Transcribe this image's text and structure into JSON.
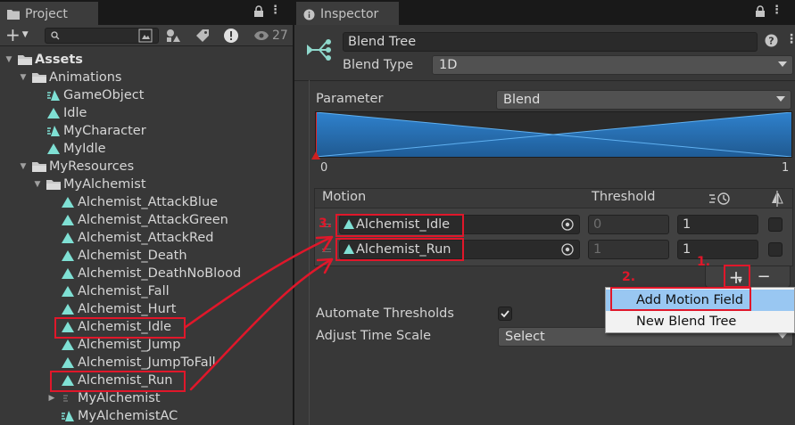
{
  "project": {
    "tab_label": "Project",
    "hidden_count": "27",
    "tree": [
      {
        "label": "Assets",
        "bold": true,
        "arrow": "down",
        "icon": "folder-icon"
      },
      {
        "label": "Animations",
        "bold": false,
        "arrow": "down",
        "icon": "folder-icon"
      },
      {
        "label": "GameObject",
        "bold": false,
        "arrow": "",
        "icon": "animator-controller-icon"
      },
      {
        "label": "Idle",
        "bold": false,
        "arrow": "",
        "icon": "animation-clip-icon"
      },
      {
        "label": "MyCharacter",
        "bold": false,
        "arrow": "",
        "icon": "animator-controller-icon"
      },
      {
        "label": "MyIdle",
        "bold": false,
        "arrow": "",
        "icon": "animation-clip-icon"
      },
      {
        "label": "MyResources",
        "bold": false,
        "arrow": "down",
        "icon": "folder-icon"
      },
      {
        "label": "MyAlchemist",
        "bold": false,
        "arrow": "down",
        "icon": "folder-icon"
      },
      {
        "label": "Alchemist_AttackBlue",
        "bold": false,
        "arrow": "",
        "icon": "animation-clip-icon"
      },
      {
        "label": "Alchemist_AttackGreen",
        "bold": false,
        "arrow": "",
        "icon": "animation-clip-icon"
      },
      {
        "label": "Alchemist_AttackRed",
        "bold": false,
        "arrow": "",
        "icon": "animation-clip-icon"
      },
      {
        "label": "Alchemist_Death",
        "bold": false,
        "arrow": "",
        "icon": "animation-clip-icon"
      },
      {
        "label": "Alchemist_DeathNoBlood",
        "bold": false,
        "arrow": "",
        "icon": "animation-clip-icon"
      },
      {
        "label": "Alchemist_Fall",
        "bold": false,
        "arrow": "",
        "icon": "animation-clip-icon"
      },
      {
        "label": "Alchemist_Hurt",
        "bold": false,
        "arrow": "",
        "icon": "animation-clip-icon"
      },
      {
        "label": "Alchemist_Idle",
        "bold": false,
        "arrow": "",
        "icon": "animation-clip-icon"
      },
      {
        "label": "Alchemist_Jump",
        "bold": false,
        "arrow": "",
        "icon": "animation-clip-icon"
      },
      {
        "label": "Alchemist_JumpToFall",
        "bold": false,
        "arrow": "",
        "icon": "animation-clip-icon"
      },
      {
        "label": "Alchemist_Run",
        "bold": false,
        "arrow": "",
        "icon": "animation-clip-icon"
      },
      {
        "label": "MyAlchemist",
        "bold": false,
        "arrow": "right",
        "icon": "prefab-icon"
      },
      {
        "label": "MyAlchemistAC",
        "bold": false,
        "arrow": "",
        "icon": "animator-controller-icon"
      }
    ]
  },
  "inspector": {
    "tab_label": "Inspector",
    "object_name": "Blend Tree",
    "blend_type_label": "Blend Type",
    "blend_type_value": "1D",
    "parameter_label": "Parameter",
    "parameter_value": "Blend",
    "graph_min": "0",
    "graph_max": "1",
    "motion_header": "Motion",
    "threshold_header": "Threshold",
    "motions": [
      {
        "clip": "Alchemist_Idle",
        "threshold": "0",
        "speed": "1"
      },
      {
        "clip": "Alchemist_Run",
        "threshold": "1",
        "speed": "1"
      }
    ],
    "automate_thresholds_label": "Automate Thresholds",
    "adjust_time_scale_label": "Adjust Time Scale",
    "adjust_time_scale_value": "Select",
    "add_button": "+",
    "remove_button": "−"
  },
  "context_menu": {
    "items": [
      "Add Motion Field",
      "New Blend Tree"
    ]
  },
  "annotations": {
    "step1": "1.",
    "step2": "2.",
    "step3": "3."
  },
  "colors": {
    "annotation_red": "#e0172a",
    "graph_blue": "#2a6fb0",
    "menu_highlight": "#99c7f2",
    "clip_icon_teal": "#7fe0d4"
  }
}
